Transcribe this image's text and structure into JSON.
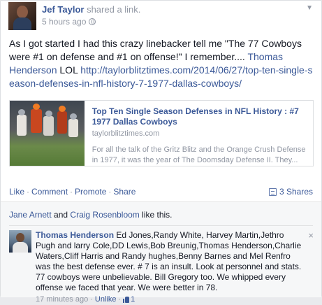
{
  "post": {
    "author": "Jef Taylor",
    "action": "shared a link.",
    "timestamp": "5 hours ago",
    "privacy_icon": "globe-icon",
    "menu_icon": "chevron-down-icon",
    "text_intro": "As I got started I had this crazy linebacker tell me \"The 77 Cowboys were #1 on defense and #1 on offense!\" I remember.... ",
    "text_mention": "Thomas Henderson",
    "text_suffix": " LOL ",
    "text_link": "http://taylorblitztimes.com/2014/06/27/top-ten-single-season-defenses-in-nfl-history-7-1977-dallas-cowboys/"
  },
  "shared_link": {
    "title": "Top Ten Single Season Defenses in NFL History : #7 1977 Dallas Cowboys",
    "domain": "taylorblitztimes.com",
    "description": "For all the talk of the Gritz Blitz and the Orange Crush Defense in 1977, it was the year of The Doomsday Defense II. They..."
  },
  "actions": {
    "like": "Like",
    "comment": "Comment",
    "promote": "Promote",
    "share": "Share",
    "shares_count": "3 Shares",
    "separator": "·"
  },
  "likes": {
    "name1": "Jane Arnett",
    "connector": " and ",
    "name2": "Craig Rosenbloom",
    "suffix": " like this."
  },
  "comment": {
    "author": "Thomas Henderson",
    "text": " Ed Jones,Randy White, Harvey Martin,Jethro Pugh and larry Cole,DD Lewis,Bob Breunig,Thomas Henderson,Charlie Waters,Cliff Harris and Randy hughes,Benny Barnes and Mel Renfro was the best defense ever. # 7 is an insult. Look at personnel and stats. 77 cowboys were unbelievable. Bill Gregory too. We whipped every offense we faced that year. We were better in 78.",
    "timestamp": "17 minutes ago",
    "unlike": "Unlike",
    "like_count": "1",
    "close": "×"
  }
}
